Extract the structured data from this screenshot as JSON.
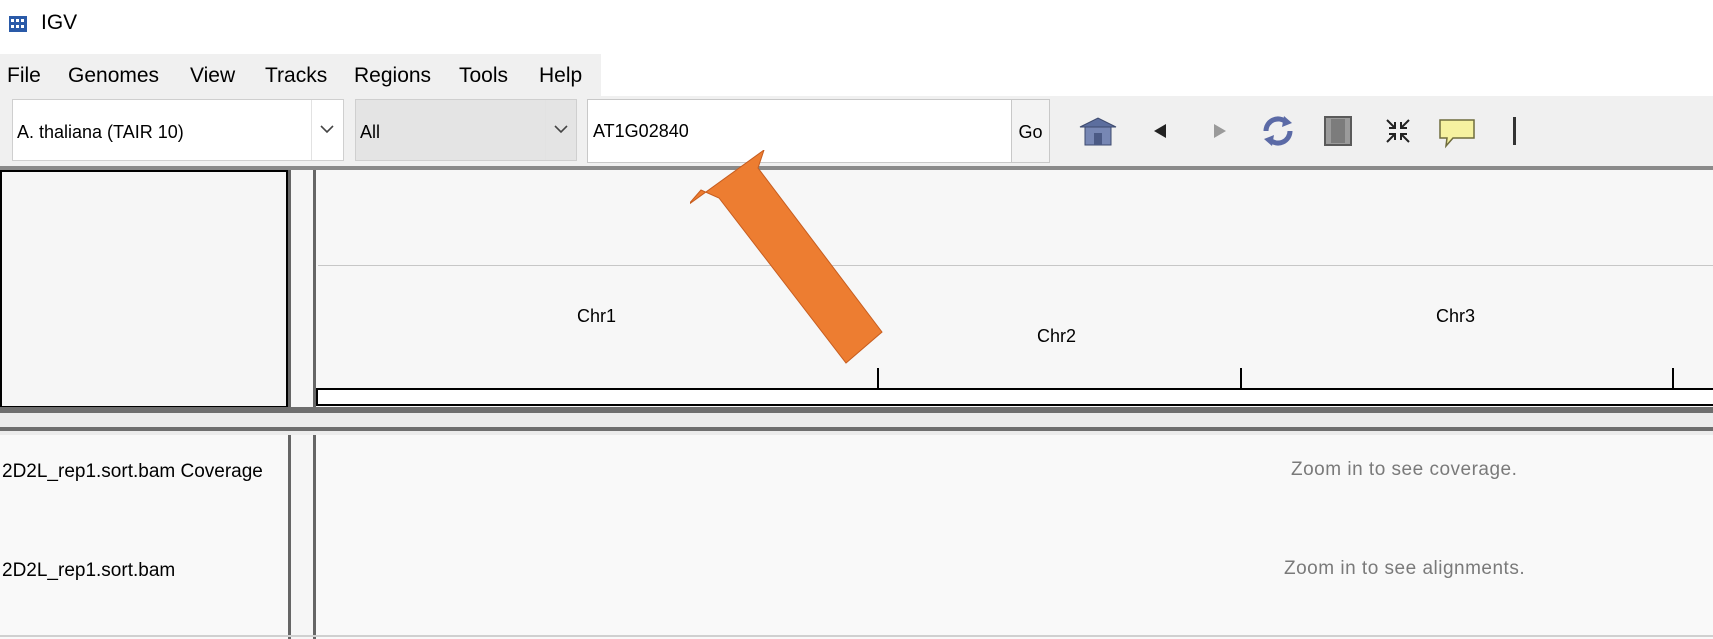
{
  "window": {
    "title": "IGV",
    "icon": "igv-app-icon"
  },
  "menubar": {
    "items": [
      {
        "label": "File"
      },
      {
        "label": "Genomes"
      },
      {
        "label": "View"
      },
      {
        "label": "Tracks"
      },
      {
        "label": "Regions"
      },
      {
        "label": "Tools"
      },
      {
        "label": "Help"
      }
    ]
  },
  "toolbar": {
    "genome_select": {
      "value": "A. thaliana (TAIR 10)"
    },
    "chromosome_select": {
      "value": "All"
    },
    "locus_input": {
      "value": "AT1G02840"
    },
    "go_label": "Go",
    "icons": [
      "home-icon",
      "back-arrow-icon",
      "forward-arrow-icon",
      "refresh-icon",
      "region-of-interest-icon",
      "resize-to-window-icon",
      "popup-text-icon",
      "ruler-line-icon"
    ]
  },
  "ruler": {
    "chromosomes": [
      {
        "label": "Chr1"
      },
      {
        "label": "Chr2"
      },
      {
        "label": "Chr3"
      }
    ]
  },
  "tracks": [
    {
      "name": "2D2L_rep1.sort.bam Coverage",
      "message": "Zoom in to see coverage."
    },
    {
      "name": "2D2L_rep1.sort.bam",
      "message": "Zoom in to see alignments."
    }
  ],
  "annotation": {
    "arrow_color": "#ED7D31",
    "arrow_target": "locus-input"
  }
}
